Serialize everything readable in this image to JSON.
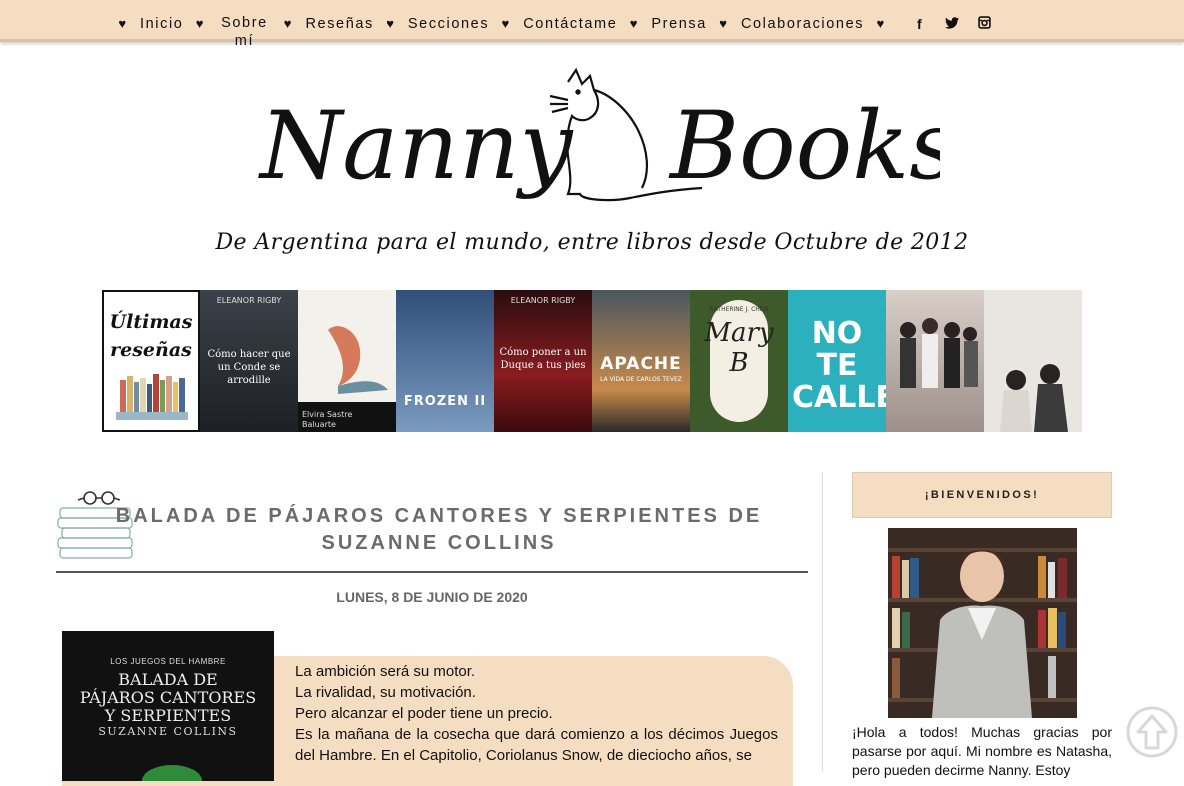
{
  "nav": {
    "items": [
      {
        "label": "Inicio"
      },
      {
        "label": "Sobre mí"
      },
      {
        "label": "Reseñas"
      },
      {
        "label": "Secciones"
      },
      {
        "label": "Contáctame"
      },
      {
        "label": "Prensa"
      },
      {
        "label": "Colaboraciones"
      }
    ],
    "heart": "♥",
    "social": [
      "facebook-icon",
      "twitter-icon",
      "instagram-icon"
    ]
  },
  "header": {
    "logo_left": "Nanny",
    "logo_right": "Books",
    "tagline": "De Argentina para el mundo, entre libros desde Octubre de 2012"
  },
  "reviews_strip": {
    "label_line1": "Últimas",
    "label_line2": "reseñas",
    "covers": [
      {
        "title": "Cómo hacer que un Conde se arrodille",
        "author": "ELEANOR RIGBY",
        "bg": "#2b2f35"
      },
      {
        "title": "Baluarte",
        "author": "Elvira Sastre",
        "bg": "#f3f1ec"
      },
      {
        "title": "FROZEN II",
        "author": "",
        "bg": "#3d5f8f"
      },
      {
        "title": "Cómo poner a un Duque a tus pies",
        "author": "ELEANOR RIGBY",
        "bg": "#6e1418"
      },
      {
        "title": "APACHE",
        "author": "LA VIDA DE CARLOS TEVEZ",
        "bg": "#3c4a55"
      },
      {
        "title": "Mary B",
        "author": "KATHERINE J. CHEN",
        "bg": "#3d5a2a"
      },
      {
        "title": "NO TE CALLES",
        "author": "",
        "bg": "#2db0bd"
      },
      {
        "title": "",
        "author": "",
        "bg": "#b9a7a0"
      },
      {
        "title": "",
        "author": "",
        "bg": "#e9e6e2"
      }
    ]
  },
  "post": {
    "title": "BALADA DE PÁJAROS CANTORES Y SERPIENTES DE SUZANNE COLLINS",
    "date": "LUNES, 8 DE JUNIO DE 2020",
    "book_cover": {
      "series": "LOS JUEGOS DEL HAMBRE",
      "title_line1": "BALADA DE",
      "title_line2": "PÁJAROS CANTORES",
      "title_line3": "Y SERPIENTES",
      "author": "SUZANNE COLLINS"
    },
    "excerpt": [
      "La ambición será su motor.",
      "La rivalidad, su motivación.",
      "Pero alcanzar el poder tiene un precio.",
      "Es la mañana de la cosecha que dará comienzo a los décimos Juegos del Hambre. En el Capitolio, Coriolanus Snow, de dieciocho años, se"
    ]
  },
  "sidebar": {
    "welcome_title": "¡BIENVENIDOS!",
    "welcome_text": "¡Hola a todos! Muchas gracias por pasarse por aquí. Mi nombre es Natasha, pero pueden decirme Nanny. Estoy"
  },
  "colors": {
    "accent": "#f5ddc2",
    "title_gray": "#6b6b6b"
  }
}
